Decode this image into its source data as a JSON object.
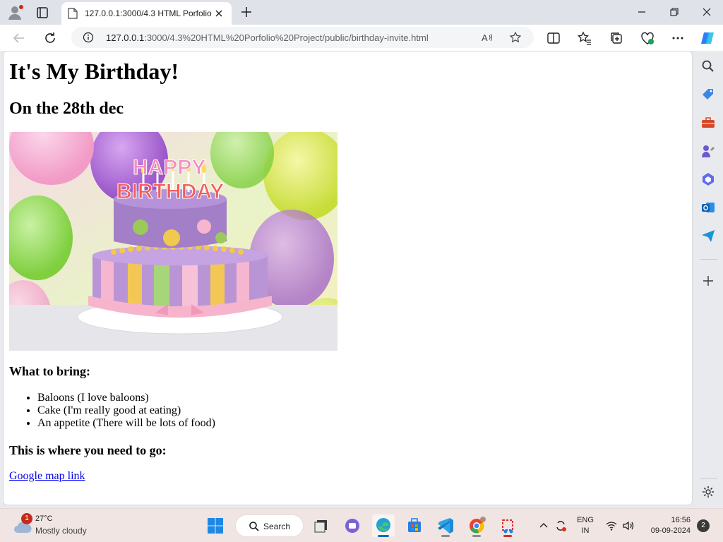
{
  "browser": {
    "tab": {
      "title": "127.0.0.1:3000/4.3 HTML Porfolio"
    },
    "address": {
      "host": "127.0.0.1",
      "path": ":3000/4.3%20HTML%20Porfolio%20Project/public/birthday-invite.html"
    }
  },
  "page": {
    "heading": "It's My Birthday!",
    "date_heading": "On the 28th dec",
    "image": {
      "overlay_text_top": "HAPPY",
      "overlay_text_bottom": "BIRTHDAY"
    },
    "bring_heading": "What to bring:",
    "bring_items": [
      "Baloons (I love baloons)",
      "Cake (I'm really good at eating)",
      "An appetite (There will be lots of food)"
    ],
    "where_heading": "This is where you need to go:",
    "map_link": "Google map link"
  },
  "taskbar": {
    "weather": {
      "badge": "1",
      "temp": "27°C",
      "condition": "Mostly cloudy"
    },
    "search_label": "Search",
    "language": {
      "line1": "ENG",
      "line2": "IN"
    },
    "clock": {
      "time": "16:56",
      "date": "09-09-2024"
    },
    "notification_count": "2"
  },
  "colors": {
    "link": "#0000ee",
    "titlebar": "#dfe2e8",
    "taskbar": "#f0e5e3",
    "active_indicator": "#0f6cbd"
  }
}
